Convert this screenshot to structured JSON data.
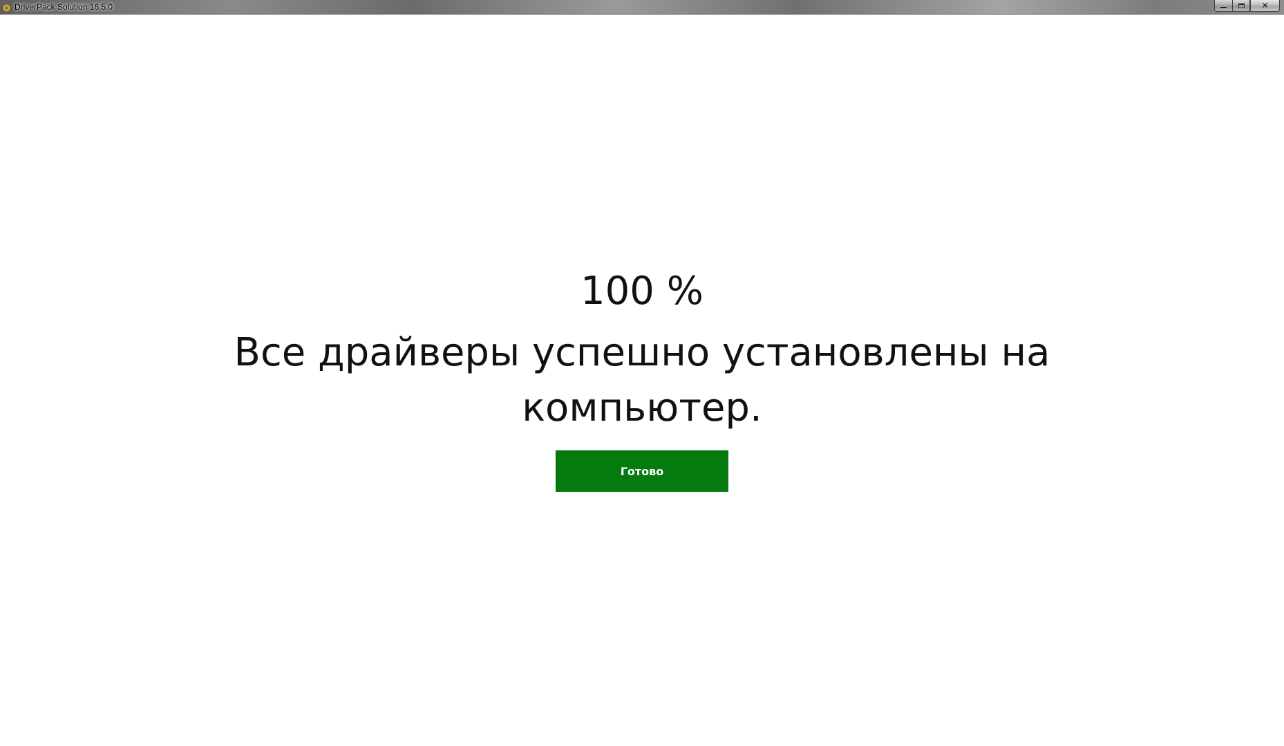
{
  "window": {
    "title": "DriverPack Solution 16.5.0",
    "app_icon": "driverpack-logo-icon",
    "controls": {
      "minimize_icon": "minimize-icon",
      "maximize_icon": "maximize-icon",
      "close_icon": "close-icon",
      "close_glyph": "✕"
    }
  },
  "status": {
    "progress": "100 %",
    "progress_value": 100,
    "message": "Все драйверы успешно установлены на компьютер."
  },
  "actions": {
    "done_label": "Готово",
    "done_color": "#057a0e"
  }
}
